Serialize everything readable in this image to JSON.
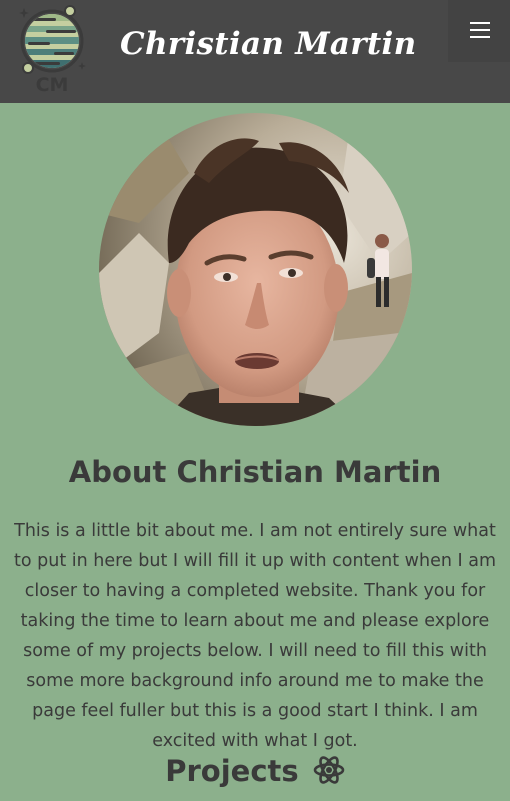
{
  "header": {
    "site_name": "Christian Martin",
    "logo_text": "CM",
    "menu_icon": "hamburger-menu-icon"
  },
  "profile": {
    "photo": "profile-photo"
  },
  "about": {
    "title": "About Christian Martin",
    "body": "This is a little bit about me. I am not entirely sure what to put in here but I will fill it up with content when I am closer to having a completed website. Thank you for taking the time to learn about me and please explore some of my projects below. I will need to fill this with some more background info around me to make the page feel fuller but this is a good start I think. I am excited with what I got."
  },
  "projects": {
    "heading": "Projects",
    "icon": "atom-icon"
  },
  "colors": {
    "page_background": "#8cb08c",
    "header_background": "#484848",
    "text": "#3a3a3a",
    "header_text": "#ffffff"
  }
}
